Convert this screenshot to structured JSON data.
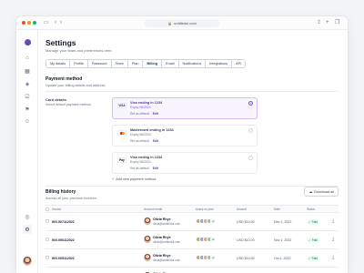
{
  "browser": {
    "url": "untitledui.com"
  },
  "header": {
    "title": "Settings",
    "subtitle": "Manage your team and preferences here."
  },
  "tabs": [
    {
      "label": "My details",
      "active": false
    },
    {
      "label": "Profile",
      "active": false
    },
    {
      "label": "Password",
      "active": false
    },
    {
      "label": "Team",
      "active": false
    },
    {
      "label": "Plan",
      "active": false
    },
    {
      "label": "Billing",
      "active": true
    },
    {
      "label": "Email",
      "active": false
    },
    {
      "label": "Notifications",
      "active": false
    },
    {
      "label": "Integrations",
      "active": false
    },
    {
      "label": "API",
      "active": false
    }
  ],
  "payment": {
    "title": "Payment method",
    "subtitle": "Update your billing details and address.",
    "card_label": "Card details",
    "card_sub": "Select default payment method.",
    "cards": [
      {
        "brand": "VISA",
        "title": "Visa ending in 1234",
        "expiry": "Expiry 06/2024",
        "set_default": "Set as default",
        "edit": "Edit",
        "selected": true
      },
      {
        "brand": "MC",
        "title": "Mastercard ending in 1234",
        "expiry": "Expiry 06/2024",
        "set_default": "Set as default",
        "edit": "Edit",
        "selected": false
      },
      {
        "brand": "Pay",
        "title": "Visa ending in 1234",
        "expiry": "Expiry 06/2024",
        "set_default": "Set as default",
        "edit": "Edit",
        "selected": false
      }
    ],
    "add_method": "Add new payment method"
  },
  "billing": {
    "title": "Billing history",
    "subtitle": "Access all your previous invoices.",
    "download_all": "Download all",
    "columns": [
      "Invoice",
      "Account email",
      "Users on plan",
      "Amount",
      "Date",
      "Status"
    ],
    "rows": [
      {
        "invoice": "INV-007112022",
        "name": "Olivia Rhye",
        "email": "olivia@untitledui.com",
        "amount": "USD $10.00",
        "date": "Dec 1, 2022",
        "status": "Paid",
        "more": "+3"
      },
      {
        "invoice": "INV-006112022",
        "name": "Olivia Rhye",
        "email": "olivia@untitledui.com",
        "amount": "USD $10.00",
        "date": "Nov 1, 2022",
        "status": "Paid",
        "more": "+3"
      },
      {
        "invoice": "INV-005112022",
        "name": "Olivia Rhye",
        "email": "olivia@untitledui.com",
        "amount": "USD $10.00",
        "date": "Oct 1, 2022",
        "status": "Paid",
        "more": "+3"
      },
      {
        "invoice": "INV-004092022",
        "name": "Olivia Rhye",
        "email": "olivia@untitledui.com",
        "amount": "USD $10.00",
        "date": "Sep 1, 2022",
        "status": "Paid",
        "more": "+3"
      }
    ]
  },
  "colors": {
    "accent": "#7f56d9",
    "success": "#027a48",
    "border": "#eaecf0"
  }
}
